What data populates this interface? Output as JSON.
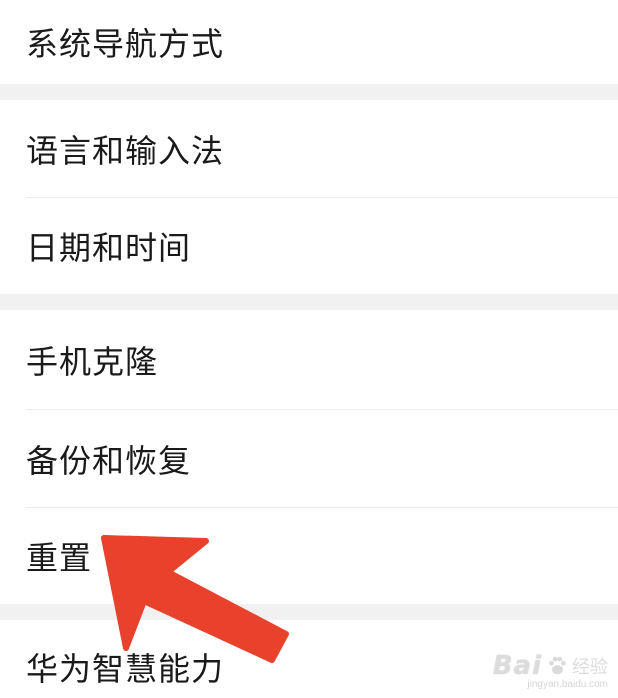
{
  "settings": {
    "items": [
      {
        "label": "系统导航方式"
      },
      {
        "label": "语言和输入法"
      },
      {
        "label": "日期和时间"
      },
      {
        "label": "手机克隆"
      },
      {
        "label": "备份和恢复"
      },
      {
        "label": "重置"
      },
      {
        "label": "华为智慧能力"
      }
    ]
  },
  "watermark": {
    "logo": "Bai",
    "brand_cn": "经验",
    "url": "jingyan.baidu.com"
  },
  "colors": {
    "arrow": "#e8412c",
    "group_gap": "#f1f1f1",
    "divider": "#ececec",
    "text": "#1a1a1a"
  }
}
